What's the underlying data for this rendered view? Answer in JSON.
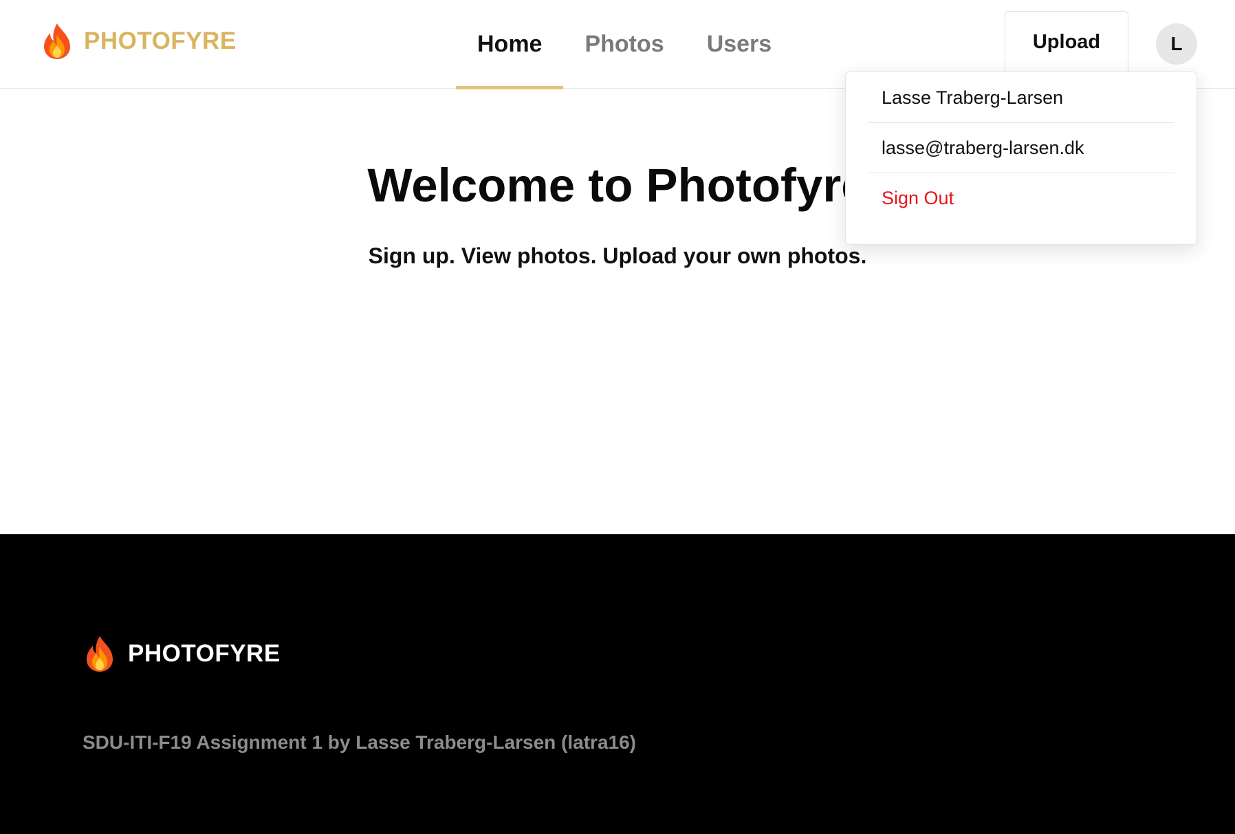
{
  "header": {
    "brand": "PHOTOFYRE",
    "brand_icon": "fire-icon",
    "nav": [
      {
        "label": "Home",
        "active": true
      },
      {
        "label": "Photos",
        "active": false
      },
      {
        "label": "Users",
        "active": false
      }
    ],
    "upload_label": "Upload",
    "avatar_initial": "L"
  },
  "dropdown": {
    "user_name": "Lasse Traberg-Larsen",
    "email": "lasse@traberg-larsen.dk",
    "sign_out": "Sign Out"
  },
  "main": {
    "title": "Welcome to Photofyre",
    "tagline": "Sign up. View photos. Upload your own photos."
  },
  "footer": {
    "brand": "PHOTOFYRE",
    "credit": "SDU-ITI-F19 Assignment 1 by Lasse Traberg-Larsen (latra16)"
  },
  "colors": {
    "brand_gold": "#d9b45f",
    "active_underline": "#e2c37a",
    "danger": "#e8141c",
    "footer_bg": "#000000"
  }
}
